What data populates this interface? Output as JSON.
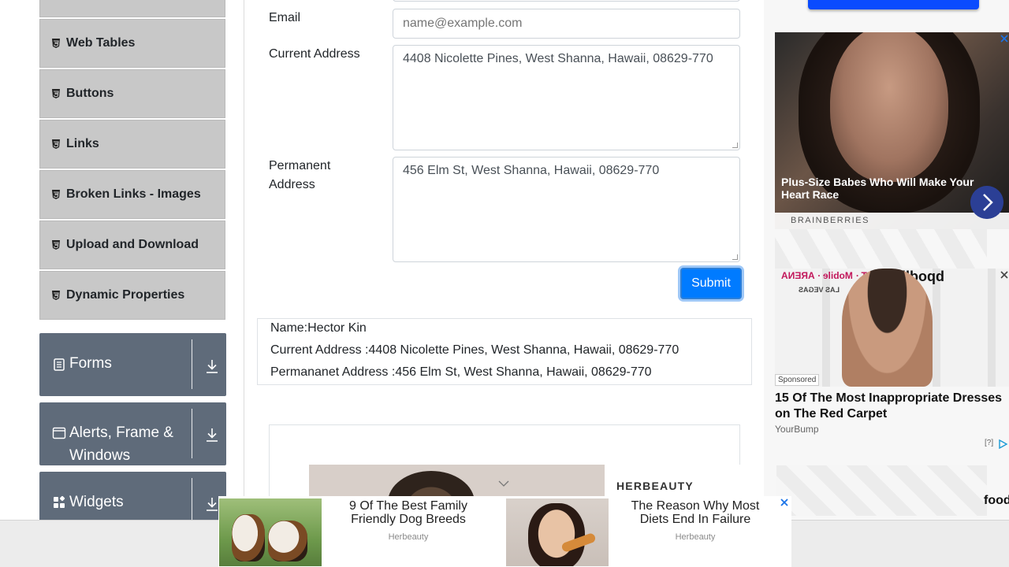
{
  "sidebar": {
    "items": [
      {
        "label": ""
      },
      {
        "label": "Web Tables"
      },
      {
        "label": "Buttons"
      },
      {
        "label": "Links"
      },
      {
        "label": "Broken Links - Images"
      },
      {
        "label": "Upload and Download"
      },
      {
        "label": "Dynamic Properties"
      }
    ],
    "groups": [
      {
        "label": "Forms",
        "icon": "document-icon"
      },
      {
        "label_line1": "Alerts, Frame &",
        "label_line2": "Windows",
        "icon": "window-icon"
      },
      {
        "label": "Widgets",
        "icon": "widgets-icon"
      }
    ]
  },
  "form": {
    "email_label": "Email",
    "email_placeholder": "name@example.com",
    "current_address_label": "Current Address",
    "current_address_value": "4408 Nicolette Pines, West Shanna, Hawaii, 08629-770",
    "permanent_address_label_line1": "Permanent",
    "permanent_address_label_line2": "Address",
    "permanent_address_value": "456 Elm St, West Shanna, Hawaii, 08629-770",
    "submit_label": "Submit"
  },
  "output": {
    "name": "Name:Hector Kin",
    "current_address": "Current Address :4408 Nicolette Pines, West Shanna, Hawaii, 08629-770",
    "permanent_address": "Permananet Address :456 Elm St, West Shanna, Hawaii, 08629-770"
  },
  "ads": {
    "ad1": {
      "caption": "Plus-Size Babes Who Will Make Your Heart Race",
      "brand": "BRAINBERRIES"
    },
    "ad2": {
      "sponsored": "Sponsored",
      "title": "15 Of The Most Inappropriate Dresses on The Red Carpet",
      "source": "YourBump",
      "info": "[?]",
      "logo_left": "T · Mobile · ARENA",
      "logo_right": "bpodllid",
      "arena_sub": "LAS VEGAS"
    },
    "food_text": "food",
    "herbeauty_label": "HERBEAUTY",
    "bottom": [
      {
        "title": "9 Of The Best Family Friendly Dog Breeds",
        "source": "Herbeauty"
      },
      {
        "title": "The Reason Why Most Diets End In Failure",
        "source": "Herbeauty"
      }
    ]
  },
  "colors": {
    "accent": "#007bff",
    "sidebar_group": "#5f6b7a",
    "sidebar_item": "#c8c8c8",
    "ad_next": "#2b3f95"
  }
}
